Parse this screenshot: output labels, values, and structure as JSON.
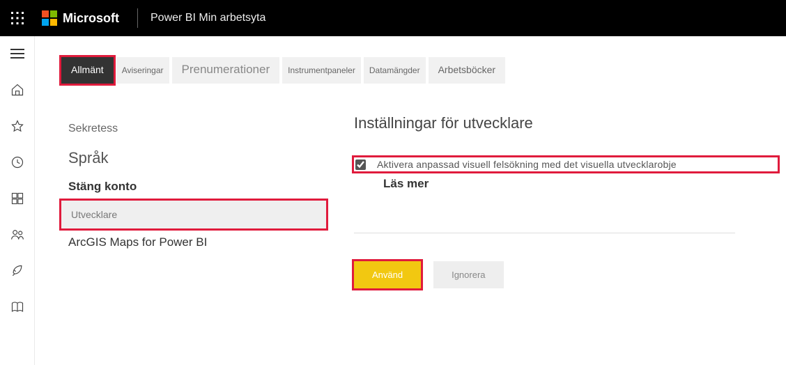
{
  "header": {
    "brand": "Microsoft",
    "app_title": "Power BI Min arbetsyta"
  },
  "tabs": {
    "general": "Allmänt",
    "alerts": "Aviseringar",
    "subscriptions": "Prenumerationer",
    "dashboards": "Instrumentpaneler",
    "datasets": "Datamängder",
    "workbooks": "Arbetsböcker"
  },
  "sidebar": {
    "privacy": "Sekretess",
    "language": "Språk",
    "close_account": "Stäng konto",
    "developer": "Utvecklare",
    "arcgis": "ArcGIS Maps for Power BI"
  },
  "panel": {
    "title": "Inställningar för utvecklare",
    "checkbox_label": "Aktivera anpassad visuell felsökning med det visuella utvecklarobje",
    "learn_more": "Läs mer",
    "apply": "Använd",
    "discard": "Ignorera"
  }
}
